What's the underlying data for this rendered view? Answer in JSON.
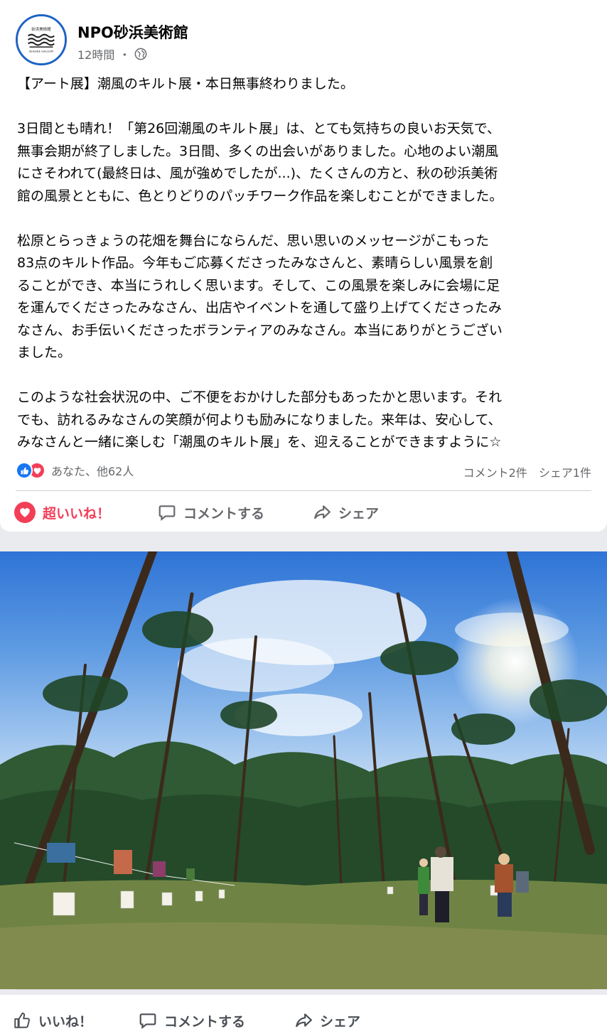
{
  "post": {
    "page_name": "NPO砂浜美術館",
    "time": "12時間",
    "separator": "・",
    "avatar_text": "砂浜美術館",
    "avatar_subtext": "SEASIDE GALLERY",
    "lines": [
      "【アート展】潮風のキルト展・本日無事終わりました。",
      "",
      "3日間とも晴れ！「第26回潮風のキルト展」は、とても気持ちの良いお天気で、",
      "無事会期が終了しました。3日間、多くの出会いがありました。心地のよい潮風",
      "にさそわれて(最終日は、風が強めでしたが...)、たくさんの方と、秋の砂浜美術",
      "館の風景とともに、色とりどりのパッチワーク作品を楽しむことができました。",
      "",
      "松原とらっきょうの花畑を舞台にならんだ、思い思いのメッセージがこもった",
      "83点のキルト作品。今年もご応募くださったみなさんと、素晴らしい風景を創",
      "ることができ、本当にうれしく思います。そして、この風景を楽しみに会場に足",
      "を運んでくださったみなさん、出店やイベントを通して盛り上げてくださったみ",
      "なさん、お手伝いくださったボランティアのみなさん。本当にありがとうござい",
      "ました。",
      "",
      "このような社会状況の中、ご不便をおかけした部分もあったかと思います。それ",
      "でも、訪れるみなさんの笑顔が何よりも励みになりました。来年は、安心して、",
      "みなさんと一緒に楽しむ「潮風のキルト展」を、迎えることができますように☆"
    ]
  },
  "reactions": {
    "names": "あなた、他62人",
    "comments": "コメント2件",
    "shares": "シェア1件"
  },
  "actions": {
    "love": "超いいね！",
    "comment": "コメントする",
    "share": "シェア"
  },
  "photo_actions": {
    "like": "いいね！",
    "comment": "コメントする",
    "share": "シェア"
  },
  "colors": {
    "love": "#f33e58",
    "like": "#1877f2",
    "muted": "#65676b"
  },
  "icons": [
    "globe-icon",
    "like-reaction-icon",
    "love-reaction-icon",
    "heart-icon",
    "comment-icon",
    "share-icon",
    "thumbs-up-icon"
  ]
}
